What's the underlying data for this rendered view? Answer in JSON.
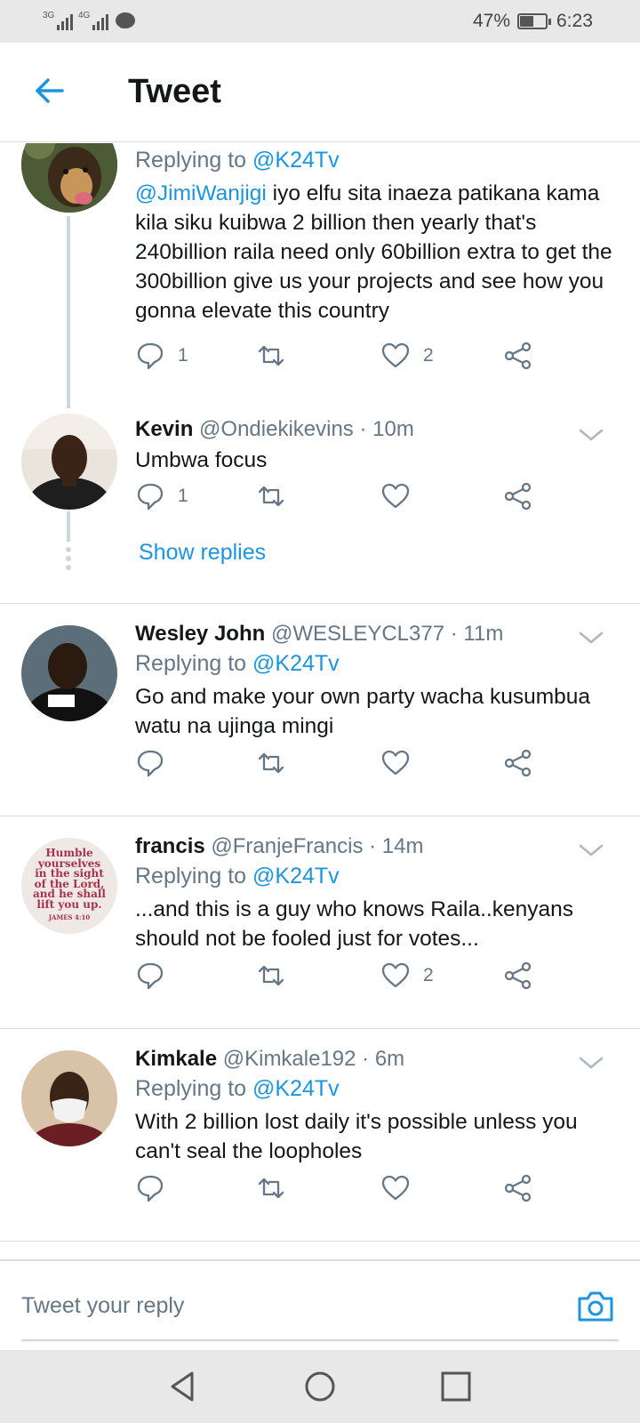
{
  "status_bar": {
    "signal_1_label": "3G",
    "signal_2_label": "4G",
    "battery_percent": "47%",
    "time": "6:23"
  },
  "app_bar": {
    "title": "Tweet"
  },
  "tweets": [
    {
      "replying_prefix": "Replying to ",
      "replying_to": "@K24Tv",
      "mention": "@JimiWanjigi",
      "text": " iyo elfu sita inaeza patikana kama kila siku kuibwa 2 billion then yearly that's 240billion raila need only 60billion extra to get the 300billion give us your projects and see how you gonna elevate this country",
      "reply_count": "1",
      "like_count": "2"
    },
    {
      "name": "Kevin",
      "handle": "@Ondiekikevins",
      "time": "· 10m",
      "text": "Umbwa focus",
      "reply_count": "1",
      "show_replies": "Show replies"
    },
    {
      "name": "Wesley John",
      "handle": "@WESLEYCL377",
      "time": "· 11m",
      "replying_prefix": "Replying to ",
      "replying_to": "@K24Tv",
      "text": "Go and make your own party wacha kusumbua watu na ujinga mingi"
    },
    {
      "name": "francis",
      "handle": "@FranjeFrancis",
      "time": "· 14m",
      "replying_prefix": "Replying to ",
      "replying_to": "@K24Tv",
      "text": "...and this is a guy who knows Raila..kenyans should not be fooled just for votes...",
      "like_count": "2",
      "avatar_text": [
        "Humble",
        "yourselves",
        "in the sight",
        "of the Lord,",
        "and he shall",
        "lift you up.",
        "JAMES 4:10"
      ]
    },
    {
      "name": "Kimkale",
      "handle": "@Kimkale192",
      "time": "· 6m",
      "replying_prefix": "Replying to ",
      "replying_to": "@K24Tv",
      "text": "With 2 billion lost daily it's possible unless you can't seal the loopholes"
    }
  ],
  "composer": {
    "placeholder": "Tweet your reply"
  },
  "colors": {
    "accent": "#1b95e0",
    "secondary_text": "#657786",
    "divider": "#d8dde0"
  }
}
